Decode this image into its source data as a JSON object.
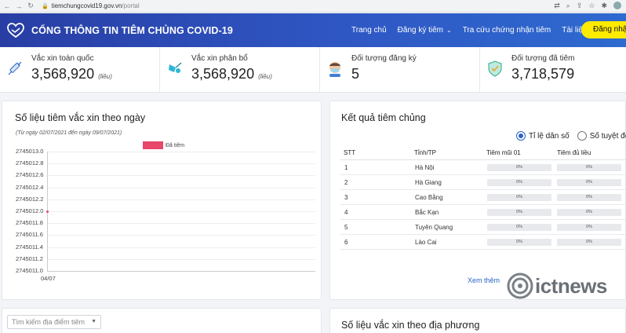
{
  "browser": {
    "url_host": "tiemchungcovid19.gov.vn",
    "url_path": "/portal"
  },
  "header": {
    "title": "CỔNG THÔNG TIN TIÊM CHỦNG COVID-19",
    "nav": [
      "Trang chủ",
      "Đăng ký tiêm",
      "Tra cứu chứng nhận tiêm",
      "Tài liệu"
    ],
    "login_label": "Đăng nhập"
  },
  "stats": [
    {
      "label": "Vắc xin toàn quốc",
      "value": "3,568,920",
      "unit": "(liều)",
      "icon": "vaccine-syringe-icon"
    },
    {
      "label": "Vắc xin phân bổ",
      "value": "3,568,920",
      "unit": "(liều)",
      "icon": "vaccine-vial-icon"
    },
    {
      "label": "Đối tượng đăng ký",
      "value": "5",
      "unit": "",
      "icon": "person-mask-icon"
    },
    {
      "label": "Đối tượng đã tiêm",
      "value": "3,718,579",
      "unit": "",
      "icon": "shield-check-icon"
    }
  ],
  "daily_chart": {
    "title": "Số liệu tiêm vắc xin theo ngày",
    "date_range": "(Từ ngày 02/07/2021 đến ngày 09/07/2021)"
  },
  "chart_data": {
    "type": "line",
    "title": "",
    "xlabel": "",
    "ylabel": "",
    "categories": [
      "04/07"
    ],
    "series": [
      {
        "name": "Đã tiêm",
        "values": [
          2745012.0
        ]
      }
    ],
    "yticks": [
      "2745013.0",
      "2745012.8",
      "2745012.6",
      "2745012.4",
      "2745012.2",
      "2745012.0",
      "2745011.8",
      "2745011.6",
      "2745011.4",
      "2745011.2",
      "2745011.0"
    ],
    "ylim": [
      2745011.0,
      2745013.0
    ],
    "legend": "top",
    "grid": true
  },
  "results": {
    "title": "Kết quả tiêm chủng",
    "radio_options": [
      "Tỉ lệ dân số",
      "Số tuyệt đối"
    ],
    "selected": 0,
    "columns": [
      "STT",
      "Tỉnh/TP",
      "Tiêm mũi 01",
      "Tiêm đủ liều"
    ],
    "rows": [
      {
        "stt": "1",
        "name": "Hà Nội",
        "dose1": "0%",
        "full": "0%"
      },
      {
        "stt": "2",
        "name": "Hà Giang",
        "dose1": "0%",
        "full": "0%"
      },
      {
        "stt": "3",
        "name": "Cao Bằng",
        "dose1": "0%",
        "full": "0%"
      },
      {
        "stt": "4",
        "name": "Bắc Kạn",
        "dose1": "0%",
        "full": "0%"
      },
      {
        "stt": "5",
        "name": "Tuyên Quang",
        "dose1": "0%",
        "full": "0%"
      },
      {
        "stt": "6",
        "name": "Lào Cai",
        "dose1": "0%",
        "full": "0%"
      }
    ],
    "see_more": "Xem thêm"
  },
  "watermark": "ictnews",
  "search": {
    "placeholder": "Tìm kiếm địa điểm tiêm"
  },
  "local_section": {
    "title": "Số liệu vắc xin theo địa phương"
  },
  "colors": {
    "header": "#2f57c4",
    "accent": "#2a63c8",
    "series": "#e8476a",
    "login": "#ffeb00"
  }
}
